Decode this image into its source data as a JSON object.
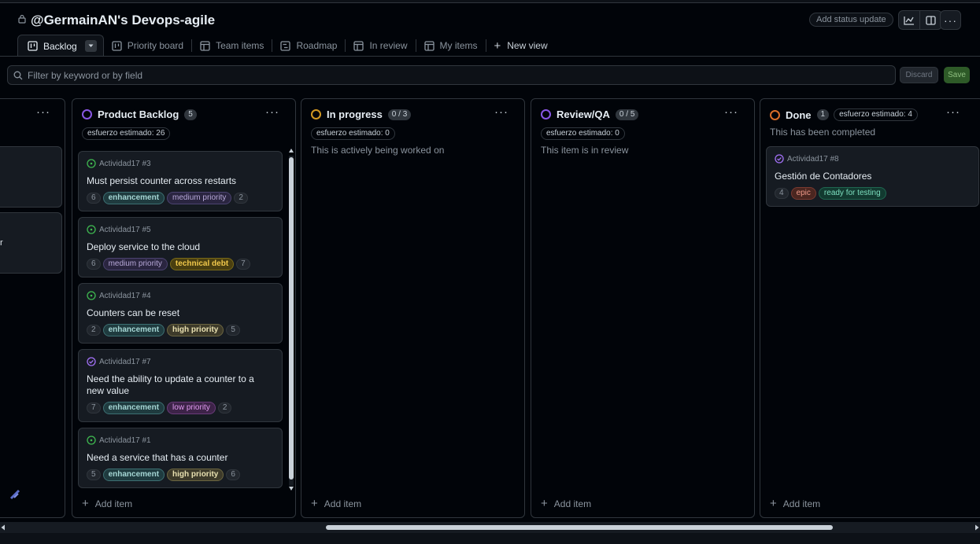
{
  "project": {
    "title": "@GermainAN's Devops-agile",
    "add_status_label": "Add status update"
  },
  "tabs": [
    {
      "label": "Backlog"
    },
    {
      "label": "Priority board"
    },
    {
      "label": "Team items"
    },
    {
      "label": "Roadmap"
    },
    {
      "label": "In review"
    },
    {
      "label": "My items"
    },
    {
      "label": "New view"
    }
  ],
  "filter": {
    "placeholder": "Filter by keyword or by field",
    "discard_label": "Discard",
    "save_label": "Save"
  },
  "columns": {
    "backlog": {
      "title": "Product Backlog",
      "count": "5",
      "estimate": "esfuerzo estimado: 26",
      "color": "#8957e5",
      "cards": [
        {
          "ref": "Actividad17 #3",
          "title": "Must persist counter across restarts",
          "a": "6",
          "b": "2",
          "labels": [
            "enhancement",
            "medium priority"
          ],
          "status": "open"
        },
        {
          "ref": "Actividad17 #5",
          "title": "Deploy service to the cloud",
          "a": "6",
          "b": "7",
          "labels": [
            "medium priority",
            "technical debt"
          ],
          "status": "open"
        },
        {
          "ref": "Actividad17 #4",
          "title": "Counters can be reset",
          "a": "2",
          "b": "5",
          "labels": [
            "enhancement",
            "high priority"
          ],
          "status": "open"
        },
        {
          "ref": "Actividad17 #7",
          "title": "Need the ability to update a counter to a new value",
          "a": "7",
          "b": "2",
          "labels": [
            "enhancement",
            "low priority"
          ],
          "status": "closed"
        },
        {
          "ref": "Actividad17 #1",
          "title": "Need a service that has a counter",
          "a": "5",
          "b": "6",
          "labels": [
            "enhancement",
            "high priority"
          ],
          "status": "open"
        }
      ]
    },
    "inprogress": {
      "title": "In progress",
      "count": "0 / 3",
      "estimate": "esfuerzo estimado: 0",
      "desc": "This is actively being worked on",
      "color": "#d29922"
    },
    "review": {
      "title": "Review/QA",
      "count": "0 / 5",
      "estimate": "esfuerzo estimado: 0",
      "desc": "This item is in review",
      "color": "#8957e5"
    },
    "done": {
      "title": "Done",
      "count": "1",
      "estimate": "esfuerzo estimado: 4",
      "desc": "This has been completed",
      "color": "#db6d28",
      "cards": [
        {
          "ref": "Actividad17 #8",
          "title": "Gestión de Contadores",
          "a": "4",
          "labels": [
            "epic",
            "ready for testing"
          ],
          "status": "closed"
        }
      ]
    }
  },
  "add_item_label": "Add item",
  "colors": {
    "open_issue": "#3fb950",
    "closed_issue": "#a371f7",
    "background": "#010409"
  }
}
